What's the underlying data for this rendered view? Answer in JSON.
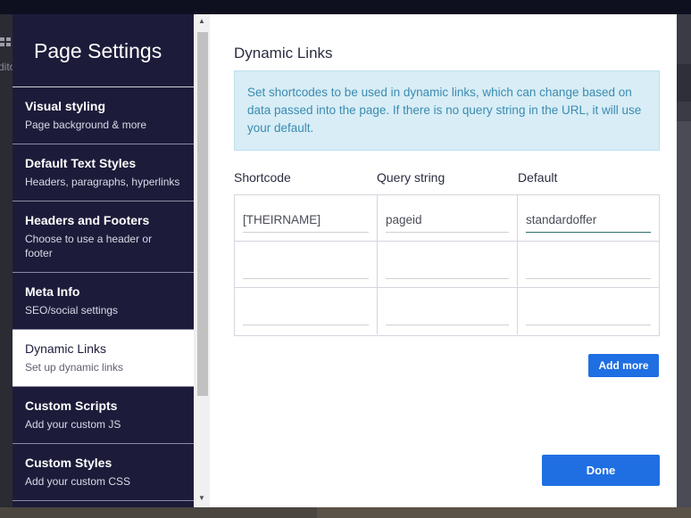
{
  "background": {
    "edit_fragment": "dito"
  },
  "sidebar": {
    "title": "Page Settings",
    "items": [
      {
        "label": "Visual styling",
        "desc": "Page background & more"
      },
      {
        "label": "Default Text Styles",
        "desc": "Headers, paragraphs, hyperlinks"
      },
      {
        "label": "Headers and Footers",
        "desc": "Choose to use a header or footer"
      },
      {
        "label": "Meta Info",
        "desc": "SEO/social settings"
      },
      {
        "label": "Dynamic Links",
        "desc": "Set up dynamic links",
        "active": true
      },
      {
        "label": "Custom Scripts",
        "desc": "Add your custom JS"
      },
      {
        "label": "Custom Styles",
        "desc": "Add your custom CSS"
      }
    ]
  },
  "main": {
    "title": "Dynamic Links",
    "info": "Set shortcodes to be used in dynamic links, which can change based on data passed into the page. If there is no query string in the URL, it will use your default.",
    "columns": {
      "shortcode": "Shortcode",
      "query": "Query string",
      "default": "Default"
    },
    "rows": [
      {
        "shortcode": "[THEIRNAME]",
        "query": "pageid",
        "default": "standardoffer"
      },
      {
        "shortcode": "",
        "query": "",
        "default": ""
      },
      {
        "shortcode": "",
        "query": "",
        "default": ""
      }
    ],
    "add_more_label": "Add more",
    "done_label": "Done"
  },
  "colors": {
    "sidebar_bg": "#1c1c3a",
    "accent_button": "#1f6fe3",
    "info_bg": "#d8edf6",
    "info_text": "#3b8bb0"
  }
}
